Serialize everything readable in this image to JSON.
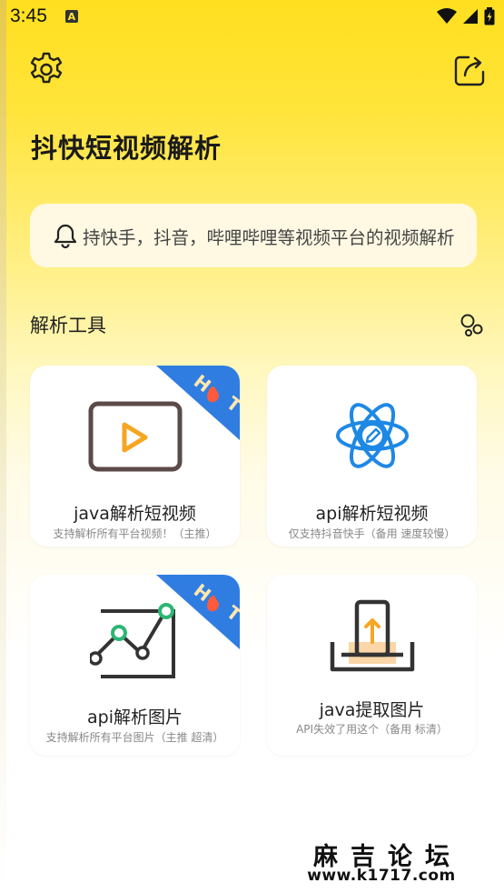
{
  "status_bar": {
    "time": "3:45",
    "notification_badge": "A"
  },
  "app": {
    "title": "抖快短视频解析",
    "notice": "持快手，抖音，哔哩哔哩等视频平台的视频解析"
  },
  "section": {
    "title": "解析工具"
  },
  "cards": [
    {
      "title": "java解析短视频",
      "subtitle": "支持解析所有平台视频！（主推）",
      "badge": "HOT",
      "icon": "play-icon"
    },
    {
      "title": "api解析短视频",
      "subtitle": "仅支持抖音快手（备用 速度较慢）",
      "badge": "",
      "icon": "atom-edit-icon"
    },
    {
      "title": "api解析图片",
      "subtitle": "支持解析所有平台图片（主推 超清）",
      "badge": "HOT",
      "icon": "line-chart-icon"
    },
    {
      "title": "java提取图片",
      "subtitle": "API失效了用这个（备用 标清）",
      "badge": "",
      "icon": "upload-tray-icon"
    }
  ],
  "watermark": {
    "title": "麻吉论坛",
    "url": "www.k1717.com"
  },
  "colors": {
    "header_yellow": "#ffe13a",
    "hot_blue": "#2f7de1",
    "hot_red": "#ff5a3c",
    "accent_orange": "#f5a623",
    "atom_blue": "#1e88e5",
    "chart_green": "#2bb673"
  }
}
